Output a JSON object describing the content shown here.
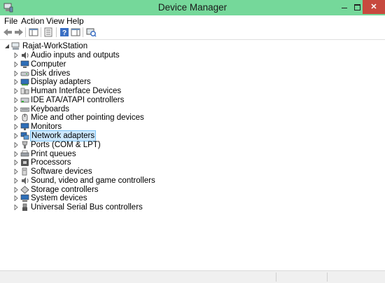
{
  "window": {
    "title": "Device Manager"
  },
  "menubar": {
    "items": [
      "File",
      "Action",
      "View",
      "Help"
    ]
  },
  "tree": {
    "root": "Rajat-WorkStation",
    "nodes": [
      {
        "label": "Audio inputs and outputs",
        "icon": "speaker-icon"
      },
      {
        "label": "Computer",
        "icon": "computer-icon"
      },
      {
        "label": "Disk drives",
        "icon": "disk-drive-icon"
      },
      {
        "label": "Display adapters",
        "icon": "display-adapter-icon"
      },
      {
        "label": "Human Interface Devices",
        "icon": "hid-icon"
      },
      {
        "label": "IDE ATA/ATAPI controllers",
        "icon": "ide-controller-icon"
      },
      {
        "label": "Keyboards",
        "icon": "keyboard-icon"
      },
      {
        "label": "Mice and other pointing devices",
        "icon": "mouse-icon"
      },
      {
        "label": "Monitors",
        "icon": "monitor-icon"
      },
      {
        "label": "Network adapters",
        "icon": "network-adapter-icon",
        "selected": true
      },
      {
        "label": "Ports (COM & LPT)",
        "icon": "port-icon"
      },
      {
        "label": "Print queues",
        "icon": "printer-icon"
      },
      {
        "label": "Processors",
        "icon": "processor-icon"
      },
      {
        "label": "Software devices",
        "icon": "software-device-icon"
      },
      {
        "label": "Sound, video and game controllers",
        "icon": "sound-controller-icon"
      },
      {
        "label": "Storage controllers",
        "icon": "storage-controller-icon"
      },
      {
        "label": "System devices",
        "icon": "system-device-icon"
      },
      {
        "label": "Universal Serial Bus controllers",
        "icon": "usb-icon"
      }
    ]
  },
  "colors": {
    "titlebar": "#75d89a",
    "close": "#c7493e",
    "selection": "#cce8ff",
    "selection_border": "#7dc4f5"
  }
}
